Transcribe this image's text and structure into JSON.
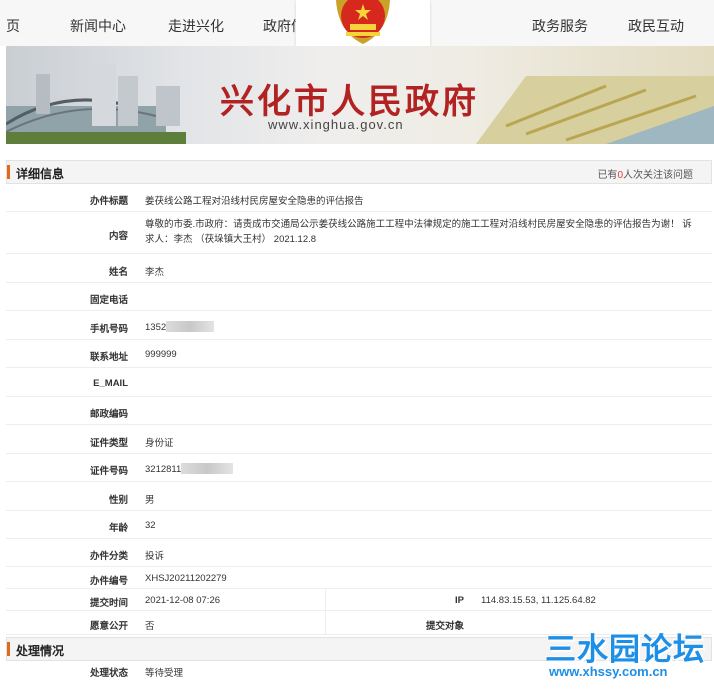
{
  "nav": {
    "items": [
      "页",
      "新闻中心",
      "走进兴化",
      "政府信",
      "政务服务",
      "政民互动"
    ]
  },
  "banner": {
    "title": "兴化市人民政府",
    "url": "www.xinghua.gov.cn"
  },
  "detail": {
    "header": "详细信息",
    "counter_prefix": "已有",
    "counter_num": "0",
    "counter_suffix": "人次关注该问题",
    "fields": {
      "title": {
        "label": "办件标题",
        "value": "姜茯线公路工程对沿线村民房屋安全隐患的评估报告"
      },
      "content": {
        "label": "内容",
        "value": "尊敬的市委.市政府：请责成市交通局公示姜茯线公路施工工程中法律规定的施工工程对沿线村民房屋安全隐患的评估报告为谢！ 诉求人：李杰 （茯垛镇大王村） 2021.12.8"
      },
      "name": {
        "label": "姓名",
        "value": "李杰"
      },
      "landline": {
        "label": "固定电话",
        "value": ""
      },
      "mobile": {
        "label": "手机号码",
        "value": "1352"
      },
      "address": {
        "label": "联系地址",
        "value": "999999"
      },
      "email": {
        "label": "E_MAIL",
        "value": ""
      },
      "postcode": {
        "label": "邮政编码",
        "value": ""
      },
      "id_type": {
        "label": "证件类型",
        "value": "身份证"
      },
      "id_no": {
        "label": "证件号码",
        "value": "3212811"
      },
      "gender": {
        "label": "性别",
        "value": "男"
      },
      "age": {
        "label": "年龄",
        "value": "32"
      },
      "category": {
        "label": "办件分类",
        "value": "投诉"
      },
      "case_no": {
        "label": "办件编号",
        "value": "XHSJ20211202279"
      },
      "submit_time": {
        "label": "提交时间",
        "value": "2021-12-08 07:26"
      },
      "ip": {
        "label": "IP",
        "value": "114.83.15.53, 11.125.64.82"
      },
      "public": {
        "label": "愿意公开",
        "value": "否"
      },
      "target": {
        "label": "提交对象",
        "value": ""
      }
    }
  },
  "processing": {
    "header": "处理情况",
    "status": {
      "label": "处理状态",
      "value": "等待受理"
    }
  },
  "watermark": {
    "title": "三水园论坛",
    "url": "www.xhssy.com.cn"
  },
  "colors": {
    "accent": "#e06a1b",
    "brand_red": "#b22222",
    "watermark_blue": "#1e8fe6"
  }
}
